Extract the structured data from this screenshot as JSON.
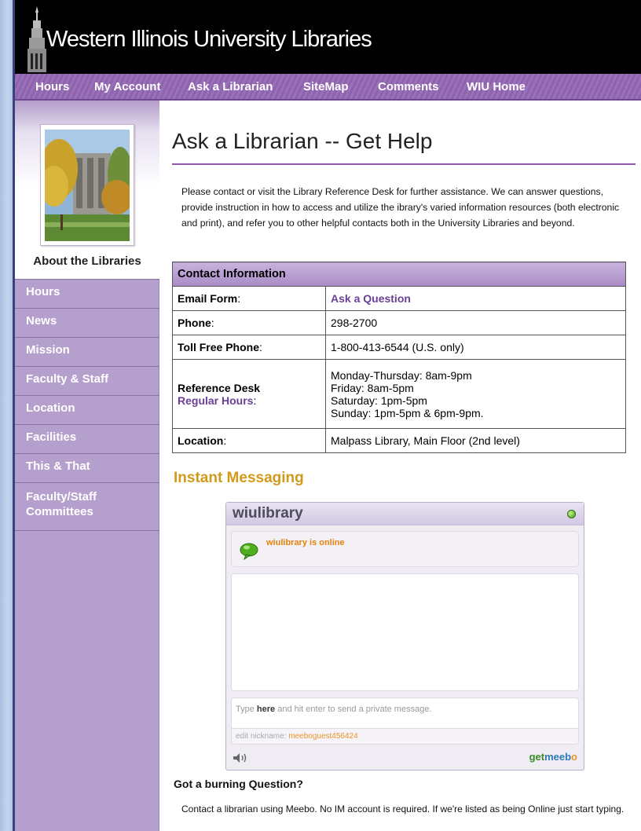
{
  "header": {
    "title": "Western Illinois University Libraries"
  },
  "nav": {
    "items": [
      {
        "label": "Hours"
      },
      {
        "label": "My Account"
      },
      {
        "label": "Ask a Librarian"
      },
      {
        "label": "SiteMap"
      },
      {
        "label": "Comments"
      },
      {
        "label": "WIU Home"
      }
    ]
  },
  "sidebar": {
    "heading": "About the Libraries",
    "items": [
      {
        "label": "Hours"
      },
      {
        "label": "News"
      },
      {
        "label": "Mission"
      },
      {
        "label": "Faculty & Staff"
      },
      {
        "label": "Location"
      },
      {
        "label": "Facilities"
      },
      {
        "label": "This & That"
      },
      {
        "label": "Faculty/Staff",
        "label2": "Committees"
      }
    ]
  },
  "main": {
    "title": "Ask a Librarian -- Get Help",
    "intro": "Please contact or visit the Library Reference Desk for further assistance. We can answer questions, provide instruction in how to access and utilize the ibrary's varied information resources (both electronic and print), and refer you to other helpful contacts both in the University Libraries and beyond.",
    "contact": {
      "header": "Contact Information",
      "email_label": "Email Form",
      "email_value": "Ask a Question",
      "phone_label": "Phone",
      "phone_value": "298-2700",
      "tollfree_label": "Toll Free Phone",
      "tollfree_value": "1-800-413-6544 (U.S. only)",
      "refdesk_label": "Reference Desk",
      "refdesk_link": "Regular Hours",
      "hours": [
        "Monday-Thursday: 8am-9pm",
        "Friday: 8am-5pm",
        "Saturday: 1pm-5pm",
        "Sunday: 1pm-5pm & 6pm-9pm."
      ],
      "location_label": "Location",
      "location_value": "Malpass Library, Main Floor (2nd level)",
      "colon": ":"
    },
    "im": {
      "heading": "Instant Messaging",
      "widget_name": "wiulibrary",
      "status": "wiulibrary is online",
      "input_pre": "Type ",
      "input_bold": "here",
      "input_post": " and hit enter to send a private message.",
      "nick_label": "edit nickname: ",
      "nickname": "meeboguest456424",
      "get_label": "get",
      "brand_label": "meeb",
      "brand_o": "o"
    },
    "burning": {
      "heading": "Got a burning Question?",
      "text": "Contact a librarian using Meebo. No IM account is required. If we're listed as being Online just start typing."
    }
  },
  "colors": {
    "accent_purple": "#8e63ad",
    "sidebar_bg": "#b59fcc",
    "im_heading": "#d19a18",
    "online_status": "#e3820c"
  }
}
